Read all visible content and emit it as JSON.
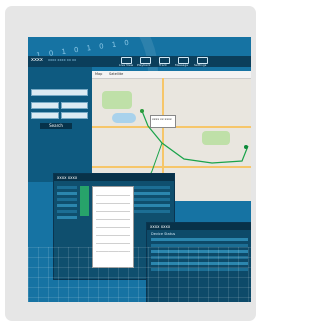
{
  "decor_text": "1 0 1 0 1 0 1 0",
  "app": {
    "title": "xxxx",
    "subtitle": "xxxx xxxx xx xx",
    "nav": [
      {
        "label": "Live View",
        "icon": "monitor-icon"
      },
      {
        "label": "Playback",
        "icon": "play-icon"
      },
      {
        "label": "Track",
        "icon": "map-icon"
      },
      {
        "label": "Message",
        "icon": "message-icon"
      },
      {
        "label": "Settings",
        "icon": "gear-icon"
      }
    ]
  },
  "left_panel": {
    "search_button": "Search"
  },
  "map": {
    "tabs": [
      "Map",
      "Satellite"
    ],
    "popup_text": "xxxx xx xxxx",
    "colors": {
      "route": "#1aa34a",
      "road": "#f6c66a",
      "park": "#bfe0a8",
      "water": "#a9d2ec"
    }
  },
  "windows": {
    "second_title": "xxxx xxxx",
    "third_title": "xxxx xxxx",
    "third_subtitle": "Device Status"
  },
  "colors": {
    "background": "#1673a3",
    "frame": "#e6e6e6",
    "topbar": "#0b3e5b",
    "panel": "#0e5a80"
  }
}
